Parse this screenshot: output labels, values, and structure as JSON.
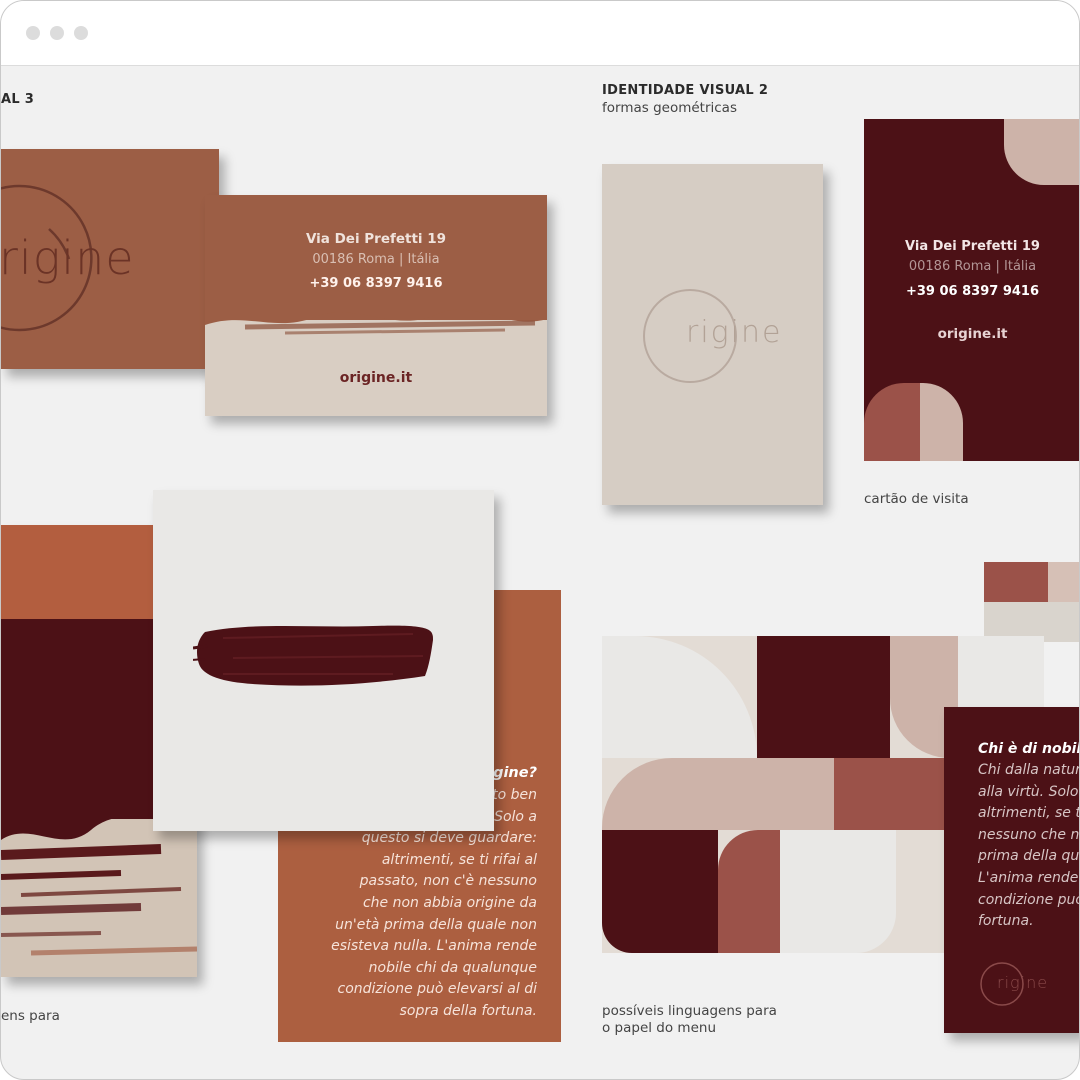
{
  "window": {
    "controls": [
      "close",
      "minimize",
      "maximize"
    ]
  },
  "left_section": {
    "title": "AL 3"
  },
  "right_section": {
    "title": "IDENTIDADE VISUAL 2",
    "subtitle": "formas geométricas"
  },
  "business_card_left": {
    "logo": "rigine",
    "street": "Via Dei Prefetti 19",
    "city": "00186 Roma | Itália",
    "phone": "+39 06 8397 9416",
    "website": "origine.it"
  },
  "business_card_right": {
    "logo": "rigine",
    "street": "Via Dei Prefetti 19",
    "city": "00186 Roma | Itália",
    "phone": "+39 06 8397 9416",
    "website": "origine.it"
  },
  "captions": {
    "left_bottom": "ens para",
    "business_card": "cartão de visita",
    "menu_line1": "possíveis linguagens para",
    "menu_line2": "o papel do menu"
  },
  "orange_menu": {
    "heading": "rigine?",
    "lines": [
      "to ben",
      "Solo a",
      "questo si deve guardare:",
      "altrimenti, se ti rifai al",
      "passato, non c'è nessuno",
      "che non abbia origine da",
      "un'età prima della quale non",
      "esisteva nulla. L'anima rende",
      "nobile chi da qualunque",
      "condizione può elevarsi al di",
      "sopra della fortuna."
    ]
  },
  "maroon_menu": {
    "heading": "Chi è di nobile",
    "lines": [
      "Chi dalla natur",
      "alla virtù. Solo c",
      "altrimenti, se ti",
      "nessuno che no",
      "prima della qua",
      "L'anima rende n",
      "condizione può",
      "fortuna."
    ],
    "logo": "rigine"
  },
  "colors": {
    "terracotta": "#9c5e45",
    "burnt_orange": "#ac5f40",
    "maroon": "#4c1116",
    "rose": "#8c4a42",
    "blush": "#cdb3a9",
    "beige": "#d6cdc4",
    "paper": "#e9e8e6"
  }
}
